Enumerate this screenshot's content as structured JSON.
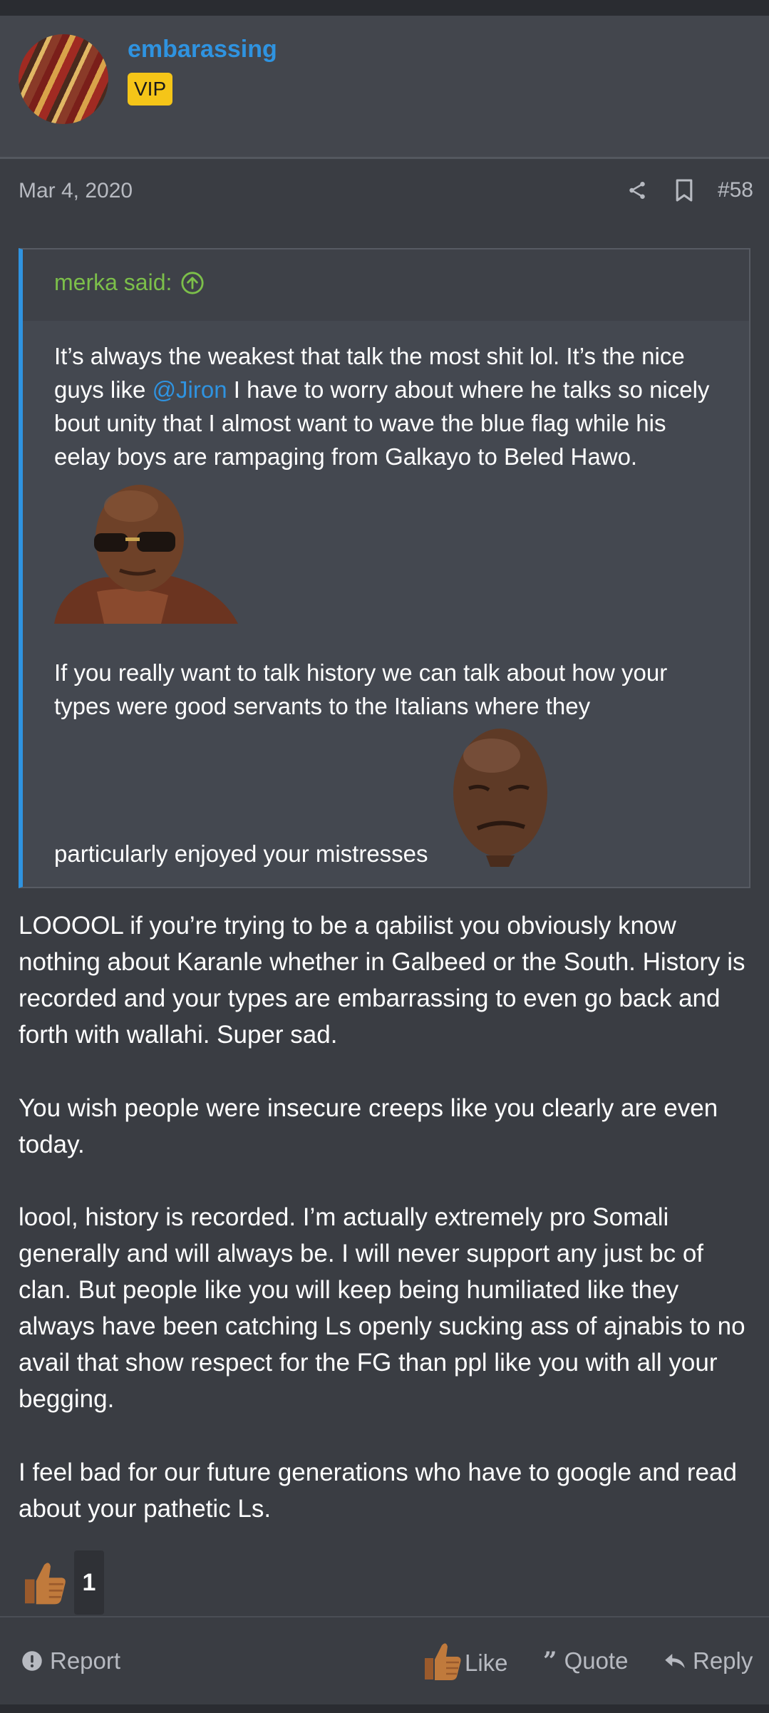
{
  "user": {
    "name": "embarassing",
    "badge": "VIP"
  },
  "post": {
    "date": "Mar 4, 2020",
    "number": "#58",
    "quote": {
      "author": "merka said:",
      "p1_before": "It’s always the weakest that talk the most shit lol. It’s the nice guys like ",
      "p1_mention": "@Jiron",
      "p1_after": " I have to worry about where he talks so nicely bout unity that I almost want to wave the blue flag while his eelay boys are rampaging from Galkayo to Beled Hawo.",
      "p2": "If you really want to talk history we can talk about how your types were good servants to the Italians where they",
      "p3": "particularly enjoyed your mistresses"
    },
    "body": [
      "LOOOOL if you’re trying to be a qabilist you obviously know nothing about Karanle whether in Galbeed or the South. History is recorded and your types are embarrassing to even go back and forth with wallahi. Super sad.",
      "You wish people were insecure creeps like you clearly are even today.",
      "loool, history is recorded. I’m actually extremely pro Somali generally and will always be. I will never support any just bc of clan. But people like you will keep being humiliated like they always have been catching Ls openly sucking ass of ajnabis to no avail that show respect for the FG than ppl like you with all your begging.",
      "I feel bad for our future generations who have to google and read about your pathetic Ls."
    ],
    "reaction_count": "1"
  },
  "footer": {
    "report": "Report",
    "like": "Like",
    "quote": "Quote",
    "reply": "Reply"
  },
  "icons": [
    "share-icon",
    "bookmark-icon",
    "arrow-up-circle-icon",
    "thumbs-up-icon",
    "alert-icon",
    "quote-icon",
    "reply-icon"
  ],
  "colors": {
    "accent": "#2f93e0",
    "quote_author": "#7cbf4a",
    "vip": "#f5c518",
    "background": "#3a3d43"
  }
}
